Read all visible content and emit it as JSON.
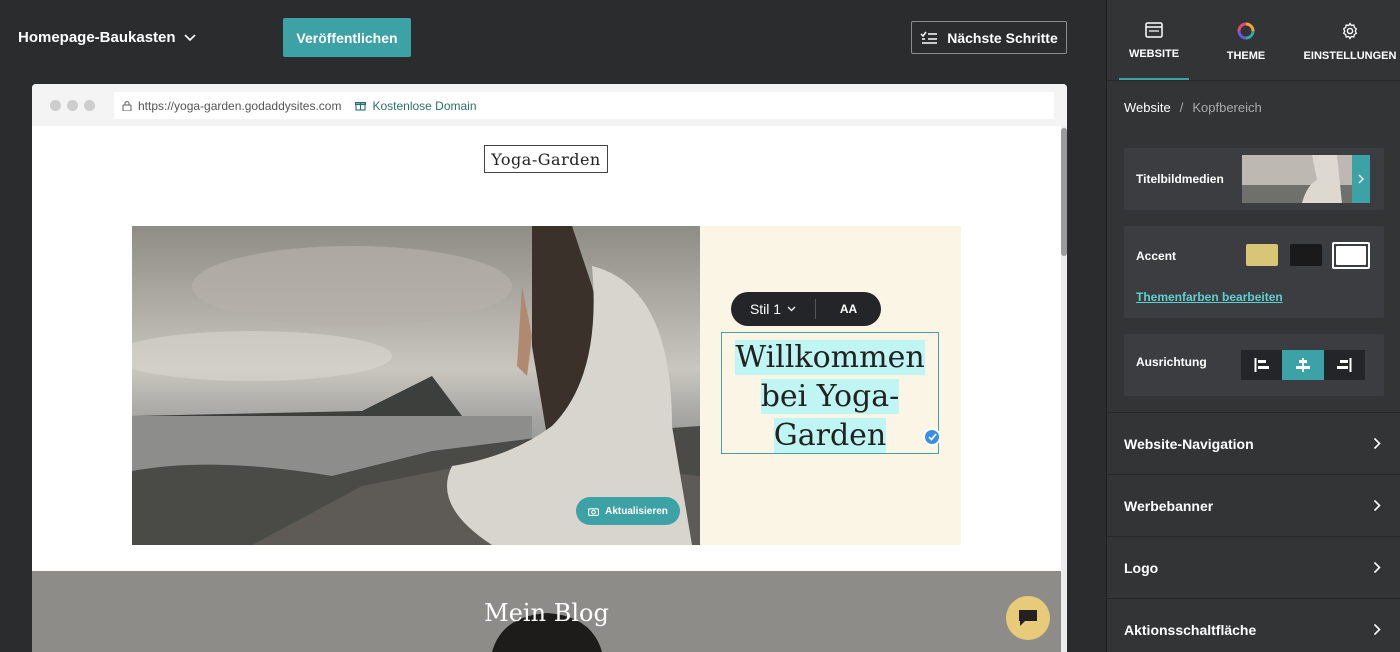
{
  "topbar": {
    "site_name": "Homepage-Baukasten",
    "publish_label": "Veröffentlichen",
    "next_steps_label": "Nächste Schritte"
  },
  "browser": {
    "url": "https://yoga-garden.godaddysites.com",
    "free_domain": "Kostenlose Domain"
  },
  "site": {
    "logo": "Yoga-Garden",
    "style_label": "Stil 1",
    "font_size_label": "AA",
    "headline_lines": [
      "Willkommen",
      "bei Yoga-",
      "Garden"
    ],
    "update_label": "Aktualisieren",
    "blog_title": "Mein Blog"
  },
  "panel": {
    "tabs": [
      {
        "label": "WEBSITE",
        "icon": "browser-window-icon",
        "active": true
      },
      {
        "label": "THEME",
        "icon": "color-ring-icon",
        "active": false
      },
      {
        "label": "EINSTELLUNGEN",
        "icon": "gear-icon",
        "active": false
      }
    ],
    "breadcrumb_root": "Website",
    "breadcrumb_sep": "/",
    "breadcrumb_current": "Kopfbereich",
    "media_label": "Titelbildmedien",
    "accent_label": "Accent",
    "accent_colors": [
      "#d8c576",
      "#1a1a1c",
      "#ffffff"
    ],
    "edit_colors_link": "Themenfarben bearbeiten",
    "alignment_label": "Ausrichtung",
    "alignment_selected": "center",
    "nav_items": [
      "Website-Navigation",
      "Werbebanner",
      "Logo",
      "Aktionsschaltfläche"
    ]
  },
  "colors": {
    "accent": "#3da2a5",
    "panel_bg": "#333436",
    "canvas_bg": "#2b2c2e"
  }
}
